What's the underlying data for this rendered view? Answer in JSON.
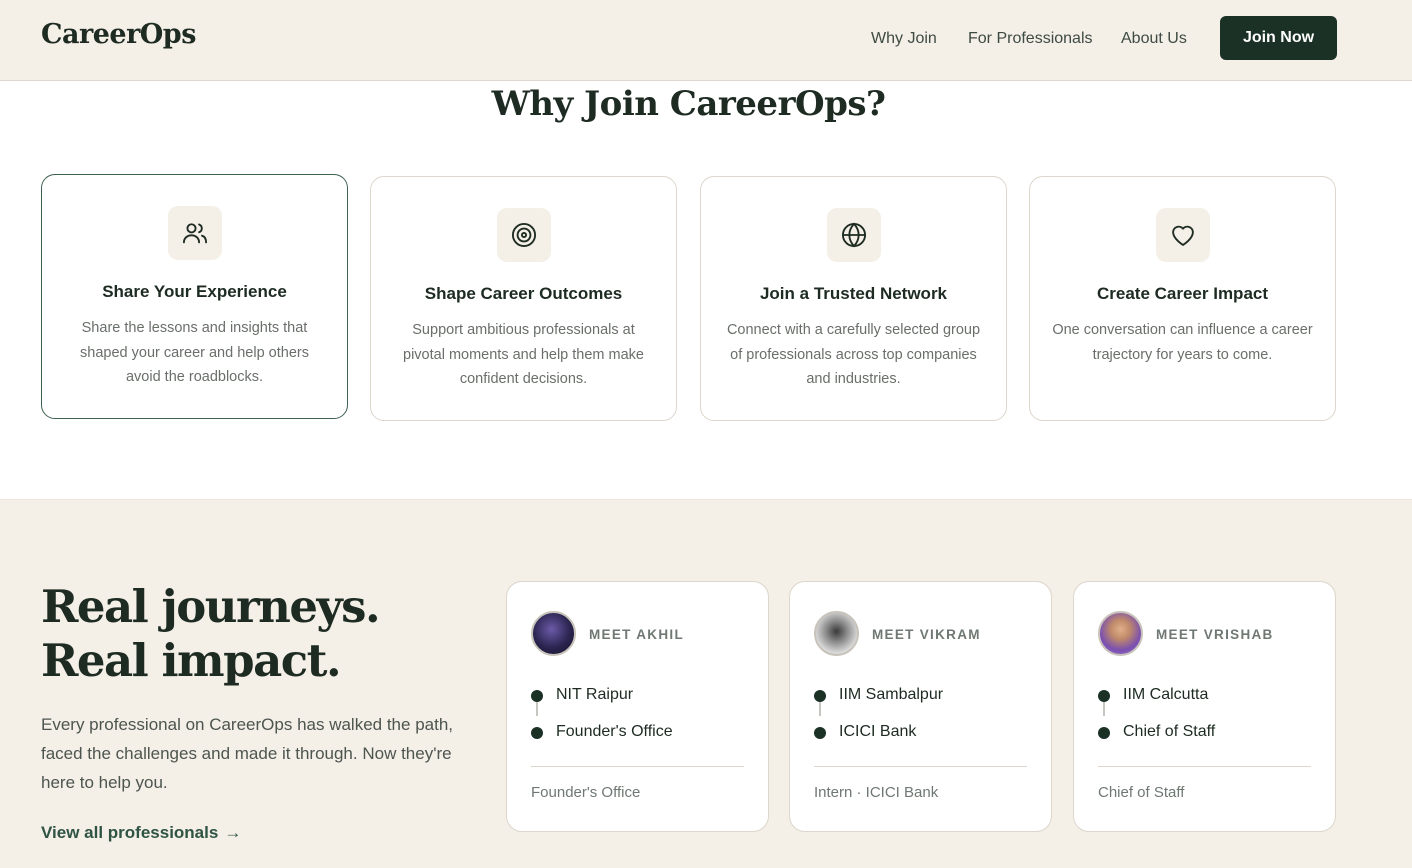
{
  "header": {
    "logo": "CareerOps",
    "nav": [
      "Why Join",
      "For Professionals",
      "About Us"
    ],
    "cta": "Join Now"
  },
  "why_join": {
    "title": "Why Join CareerOps?",
    "cards": [
      {
        "icon": "users-icon",
        "title": "Share Your Experience",
        "desc": "Share the lessons and insights that shaped your career and help others avoid the roadblocks."
      },
      {
        "icon": "target-icon",
        "title": "Shape Career Outcomes",
        "desc": "Support ambitious professionals at pivotal moments and help them make confident decisions."
      },
      {
        "icon": "globe-icon",
        "title": "Join a Trusted Network",
        "desc": "Connect with a carefully selected group of professionals across top companies and industries."
      },
      {
        "icon": "heart-icon",
        "title": "Create Career Impact",
        "desc": "One conversation can influence a career trajectory for years to come."
      }
    ]
  },
  "journeys": {
    "heading_line1": "Real journeys.",
    "heading_line2": "Real impact.",
    "desc": "Every professional on CareerOps has walked the path, faced the challenges and made it through. Now they're here to help you.",
    "link": "View all professionals",
    "link_arrow": "→",
    "professionals": [
      {
        "meet": "MEET AKHIL",
        "from": "NIT Raipur",
        "to": "Founder's Office",
        "footer": "Founder's Office"
      },
      {
        "meet": "MEET VIKRAM",
        "from": "IIM Sambalpur",
        "to": "ICICI Bank",
        "footer": "Intern · ICICI Bank"
      },
      {
        "meet": "MEET VRISHAB",
        "from": "IIM Calcutta",
        "to": "Chief of Staff",
        "footer": "Chief of Staff"
      }
    ]
  },
  "colors": {
    "brand_dark": "#1c3126",
    "cream_bg": "#f4efe7",
    "muted_text": "#6a6f6a"
  }
}
